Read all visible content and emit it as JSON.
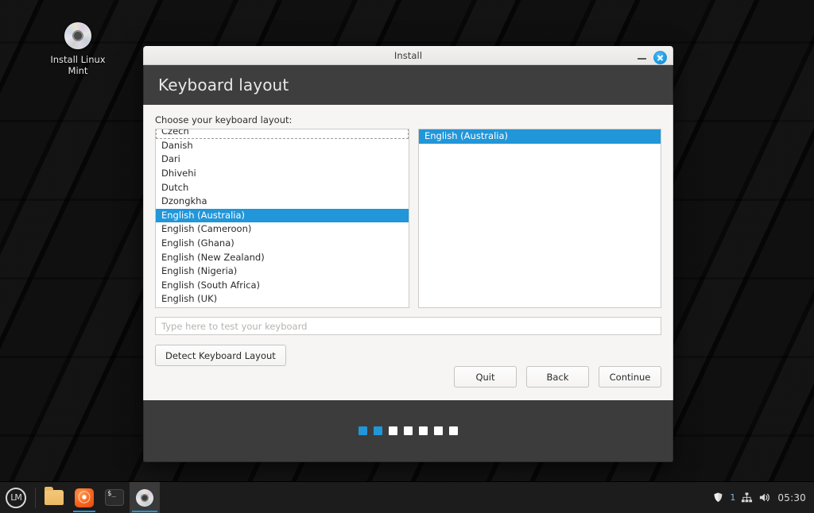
{
  "desktop": {
    "icon": {
      "name": "disc-icon",
      "label": "Install Linux Mint"
    }
  },
  "window": {
    "title": "Install",
    "page_title": "Keyboard layout",
    "controls": {
      "minimize": "minimize-icon",
      "close": "close-icon"
    },
    "accent_color": "#2196d9",
    "header_bg": "#3e3e3e",
    "footer_bg": "#3c3c3c"
  },
  "content": {
    "choose_label": "Choose your keyboard layout:",
    "layouts": [
      "Czech",
      "Danish",
      "Dari",
      "Dhivehi",
      "Dutch",
      "Dzongkha",
      "English (Australia)",
      "English (Cameroon)",
      "English (Ghana)",
      "English (New Zealand)",
      "English (Nigeria)",
      "English (South Africa)",
      "English (UK)"
    ],
    "selected_layout": "English (Australia)",
    "variants": [
      "English (Australia)"
    ],
    "selected_variant": "English (Australia)",
    "test_input": {
      "placeholder": "Type here to test your keyboard",
      "value": ""
    },
    "detect_button": "Detect Keyboard Layout"
  },
  "actions": {
    "quit": "Quit",
    "back": "Back",
    "continue": "Continue"
  },
  "progress": {
    "total_steps": 7,
    "completed_steps": 2
  },
  "taskbar": {
    "menu": "mint-menu-icon",
    "menu_label": "LM",
    "launchers": [
      {
        "name": "files-icon",
        "label": "Files"
      },
      {
        "name": "firefox-icon",
        "label": "Firefox"
      },
      {
        "name": "terminal-icon",
        "label": "Terminal",
        "glyph": "$_"
      },
      {
        "name": "installer-icon",
        "label": "Install Linux Mint"
      }
    ],
    "tray": {
      "updates_icon": "update-shield-icon",
      "updates_count": "1",
      "network_icon": "network-icon",
      "volume_icon": "volume-icon",
      "clock": "05:30"
    }
  }
}
